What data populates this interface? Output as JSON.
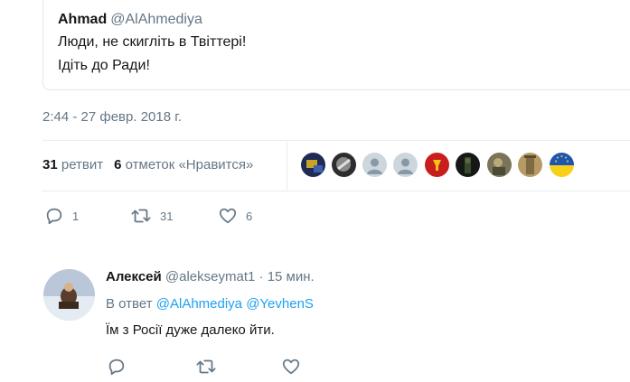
{
  "quoted_tweet": {
    "author_name": "Ahmad",
    "author_handle": "@AlAhmediya",
    "line1": "Люди, не скигліть в Твіттері!",
    "line2": "Ідіть до Ради!"
  },
  "timestamp": "2:44 - 27 февр. 2018 г.",
  "stats": {
    "retweets_count": "31",
    "retweets_label": "ретвит",
    "likes_count": "6",
    "likes_label": "отметок «Нравится»"
  },
  "likers_avatars": [
    {
      "name": "avatar-1",
      "color": "#2f3a66"
    },
    {
      "name": "avatar-2",
      "color": "#3c3c3c"
    },
    {
      "name": "avatar-default",
      "color": "#ccd6dd"
    },
    {
      "name": "avatar-default",
      "color": "#ccd6dd"
    },
    {
      "name": "avatar-flag",
      "color": "#c41e1e"
    },
    {
      "name": "avatar-dark",
      "color": "#1b1f1a"
    },
    {
      "name": "avatar-photo",
      "color": "#6d6a4f"
    },
    {
      "name": "avatar-tower",
      "color": "#9b8456"
    },
    {
      "name": "avatar-eu-flag",
      "color": "#1c55b5"
    }
  ],
  "tweet_actions": {
    "reply_count": "1",
    "retweet_count": "31",
    "like_count": "6"
  },
  "reply": {
    "author_name": "Алексей",
    "author_handle": "@alekseymat1",
    "dot": "·",
    "time": "15 мин.",
    "in_reply_prefix": "В ответ",
    "mention1": "@AlAhmediya",
    "mention2": "@YevhenS",
    "text": "Їм з Росії дуже далеко йти."
  },
  "icons": [
    "reply-icon",
    "retweet-icon",
    "like-icon"
  ],
  "colors": {
    "muted": "#657786",
    "link": "#1da1f2",
    "text": "#14171a",
    "border": "#e6ecf0"
  }
}
